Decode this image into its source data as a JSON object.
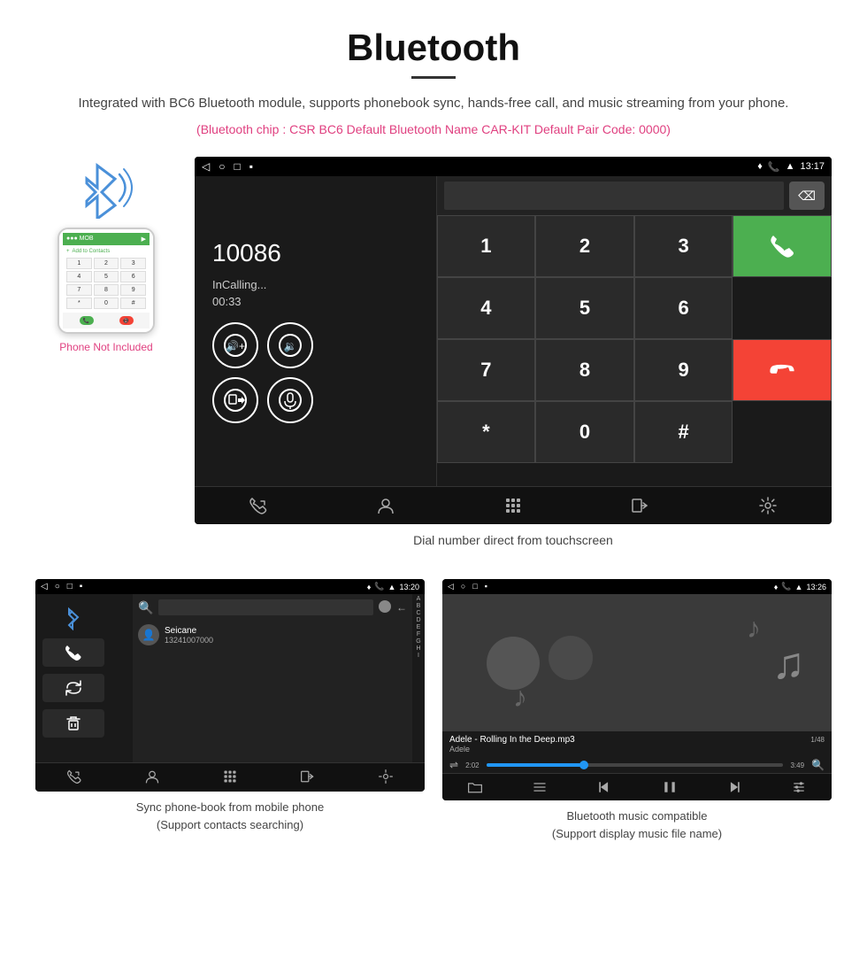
{
  "header": {
    "title": "Bluetooth",
    "description": "Integrated with BC6 Bluetooth module, supports phonebook sync, hands-free call, and music streaming from your phone.",
    "chip_info": "(Bluetooth chip : CSR BC6    Default Bluetooth Name CAR-KIT    Default Pair Code: 0000)"
  },
  "phone_label": "Phone Not Included",
  "car_screen": {
    "status_time": "13:17",
    "phone_number": "10086",
    "calling_status": "InCalling...",
    "call_duration": "00:33"
  },
  "dial_caption": "Dial number direct from touchscreen",
  "phonebook": {
    "caption": "Sync phone-book from mobile phone\n(Support contacts searching)",
    "contact_name": "Seicane",
    "contact_number": "13241007000",
    "status_time": "13:20",
    "alpha_letters": [
      "A",
      "B",
      "C",
      "D",
      "E",
      "F",
      "G",
      "H",
      "I"
    ]
  },
  "music": {
    "caption": "Bluetooth music compatible\n(Support display music file name)",
    "status_time": "13:26",
    "song": "Adele - Rolling In the Deep.mp3",
    "artist": "Adele",
    "track": "1/48",
    "time_current": "2:02",
    "time_total": "3:49"
  },
  "dialpad": {
    "keys": [
      "1",
      "2",
      "3",
      "4",
      "5",
      "6",
      "7",
      "8",
      "9",
      "*",
      "0",
      "#"
    ]
  }
}
